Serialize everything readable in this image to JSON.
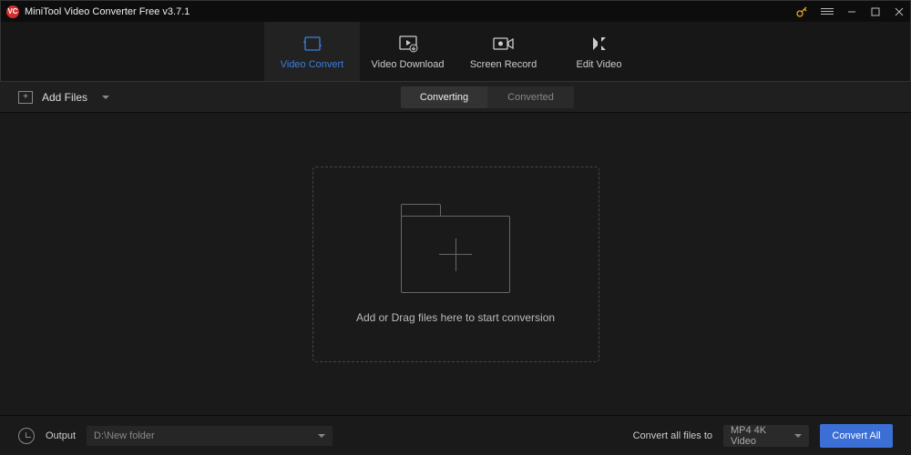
{
  "titlebar": {
    "app_icon_text": "VC",
    "title": "MiniTool Video Converter Free v3.7.1"
  },
  "maintabs": {
    "video_convert": "Video Convert",
    "video_download": "Video Download",
    "screen_record": "Screen Record",
    "edit_video": "Edit Video"
  },
  "toolbar": {
    "add_files": "Add Files"
  },
  "subtabs": {
    "converting": "Converting",
    "converted": "Converted"
  },
  "dropzone": {
    "text": "Add or Drag files here to start conversion"
  },
  "bottombar": {
    "output_label": "Output",
    "output_path": "D:\\New folder",
    "convert_all_label": "Convert all files to",
    "format": "MP4 4K Video",
    "convert_all_btn": "Convert All"
  }
}
